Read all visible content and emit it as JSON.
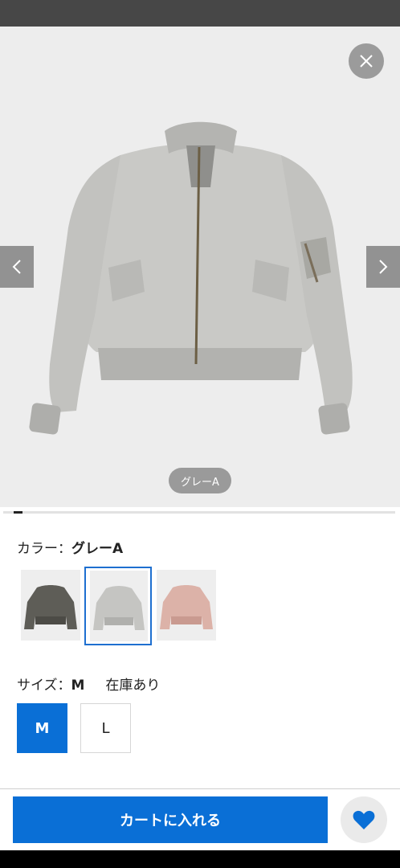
{
  "gallery": {
    "color_chip": "グレーA",
    "progress": 0.02
  },
  "product": {
    "color_label": "カラー：",
    "color_value": "グレーA",
    "swatches": [
      {
        "name": "dark-olive"
      },
      {
        "name": "gray-a",
        "selected": true
      },
      {
        "name": "pink"
      }
    ],
    "size_label": "サイズ：",
    "size_value": "M",
    "stock_text": "在庫あり",
    "sizes": [
      {
        "label": "M",
        "selected": true
      },
      {
        "label": "L",
        "selected": false
      }
    ]
  },
  "actions": {
    "add_to_cart": "カートに入れる"
  },
  "colors": {
    "accent": "#0a6fd6",
    "status_bar": "#474747"
  },
  "icons": {
    "close": "close-icon",
    "prev": "chevron-left-icon",
    "next": "chevron-right-icon",
    "favorite": "heart-icon"
  }
}
